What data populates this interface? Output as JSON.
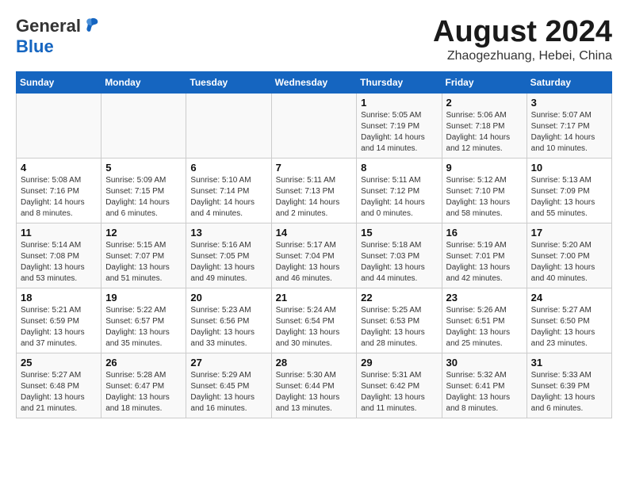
{
  "header": {
    "logo_general": "General",
    "logo_blue": "Blue",
    "month_year": "August 2024",
    "location": "Zhaogezhuang, Hebei, China"
  },
  "days_of_week": [
    "Sunday",
    "Monday",
    "Tuesday",
    "Wednesday",
    "Thursday",
    "Friday",
    "Saturday"
  ],
  "weeks": [
    [
      {
        "day": "",
        "detail": ""
      },
      {
        "day": "",
        "detail": ""
      },
      {
        "day": "",
        "detail": ""
      },
      {
        "day": "",
        "detail": ""
      },
      {
        "day": "1",
        "detail": "Sunrise: 5:05 AM\nSunset: 7:19 PM\nDaylight: 14 hours\nand 14 minutes."
      },
      {
        "day": "2",
        "detail": "Sunrise: 5:06 AM\nSunset: 7:18 PM\nDaylight: 14 hours\nand 12 minutes."
      },
      {
        "day": "3",
        "detail": "Sunrise: 5:07 AM\nSunset: 7:17 PM\nDaylight: 14 hours\nand 10 minutes."
      }
    ],
    [
      {
        "day": "4",
        "detail": "Sunrise: 5:08 AM\nSunset: 7:16 PM\nDaylight: 14 hours\nand 8 minutes."
      },
      {
        "day": "5",
        "detail": "Sunrise: 5:09 AM\nSunset: 7:15 PM\nDaylight: 14 hours\nand 6 minutes."
      },
      {
        "day": "6",
        "detail": "Sunrise: 5:10 AM\nSunset: 7:14 PM\nDaylight: 14 hours\nand 4 minutes."
      },
      {
        "day": "7",
        "detail": "Sunrise: 5:11 AM\nSunset: 7:13 PM\nDaylight: 14 hours\nand 2 minutes."
      },
      {
        "day": "8",
        "detail": "Sunrise: 5:11 AM\nSunset: 7:12 PM\nDaylight: 14 hours\nand 0 minutes."
      },
      {
        "day": "9",
        "detail": "Sunrise: 5:12 AM\nSunset: 7:10 PM\nDaylight: 13 hours\nand 58 minutes."
      },
      {
        "day": "10",
        "detail": "Sunrise: 5:13 AM\nSunset: 7:09 PM\nDaylight: 13 hours\nand 55 minutes."
      }
    ],
    [
      {
        "day": "11",
        "detail": "Sunrise: 5:14 AM\nSunset: 7:08 PM\nDaylight: 13 hours\nand 53 minutes."
      },
      {
        "day": "12",
        "detail": "Sunrise: 5:15 AM\nSunset: 7:07 PM\nDaylight: 13 hours\nand 51 minutes."
      },
      {
        "day": "13",
        "detail": "Sunrise: 5:16 AM\nSunset: 7:05 PM\nDaylight: 13 hours\nand 49 minutes."
      },
      {
        "day": "14",
        "detail": "Sunrise: 5:17 AM\nSunset: 7:04 PM\nDaylight: 13 hours\nand 46 minutes."
      },
      {
        "day": "15",
        "detail": "Sunrise: 5:18 AM\nSunset: 7:03 PM\nDaylight: 13 hours\nand 44 minutes."
      },
      {
        "day": "16",
        "detail": "Sunrise: 5:19 AM\nSunset: 7:01 PM\nDaylight: 13 hours\nand 42 minutes."
      },
      {
        "day": "17",
        "detail": "Sunrise: 5:20 AM\nSunset: 7:00 PM\nDaylight: 13 hours\nand 40 minutes."
      }
    ],
    [
      {
        "day": "18",
        "detail": "Sunrise: 5:21 AM\nSunset: 6:59 PM\nDaylight: 13 hours\nand 37 minutes."
      },
      {
        "day": "19",
        "detail": "Sunrise: 5:22 AM\nSunset: 6:57 PM\nDaylight: 13 hours\nand 35 minutes."
      },
      {
        "day": "20",
        "detail": "Sunrise: 5:23 AM\nSunset: 6:56 PM\nDaylight: 13 hours\nand 33 minutes."
      },
      {
        "day": "21",
        "detail": "Sunrise: 5:24 AM\nSunset: 6:54 PM\nDaylight: 13 hours\nand 30 minutes."
      },
      {
        "day": "22",
        "detail": "Sunrise: 5:25 AM\nSunset: 6:53 PM\nDaylight: 13 hours\nand 28 minutes."
      },
      {
        "day": "23",
        "detail": "Sunrise: 5:26 AM\nSunset: 6:51 PM\nDaylight: 13 hours\nand 25 minutes."
      },
      {
        "day": "24",
        "detail": "Sunrise: 5:27 AM\nSunset: 6:50 PM\nDaylight: 13 hours\nand 23 minutes."
      }
    ],
    [
      {
        "day": "25",
        "detail": "Sunrise: 5:27 AM\nSunset: 6:48 PM\nDaylight: 13 hours\nand 21 minutes."
      },
      {
        "day": "26",
        "detail": "Sunrise: 5:28 AM\nSunset: 6:47 PM\nDaylight: 13 hours\nand 18 minutes."
      },
      {
        "day": "27",
        "detail": "Sunrise: 5:29 AM\nSunset: 6:45 PM\nDaylight: 13 hours\nand 16 minutes."
      },
      {
        "day": "28",
        "detail": "Sunrise: 5:30 AM\nSunset: 6:44 PM\nDaylight: 13 hours\nand 13 minutes."
      },
      {
        "day": "29",
        "detail": "Sunrise: 5:31 AM\nSunset: 6:42 PM\nDaylight: 13 hours\nand 11 minutes."
      },
      {
        "day": "30",
        "detail": "Sunrise: 5:32 AM\nSunset: 6:41 PM\nDaylight: 13 hours\nand 8 minutes."
      },
      {
        "day": "31",
        "detail": "Sunrise: 5:33 AM\nSunset: 6:39 PM\nDaylight: 13 hours\nand 6 minutes."
      }
    ]
  ]
}
